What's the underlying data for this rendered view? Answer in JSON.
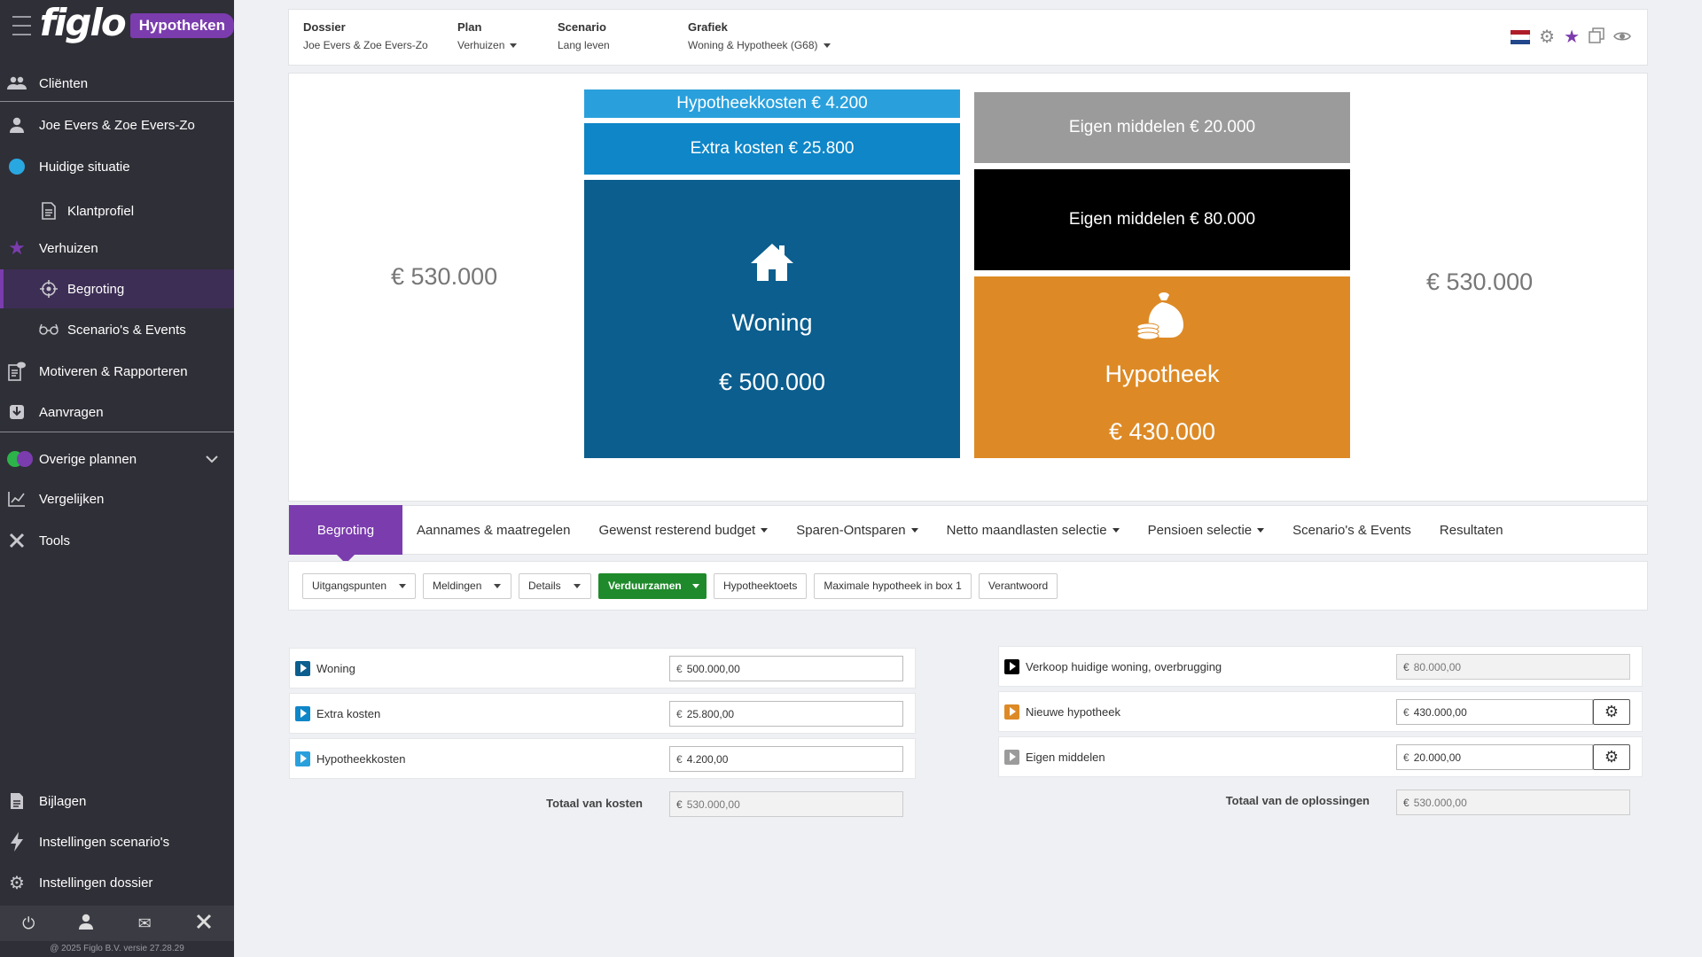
{
  "brand": {
    "logo": "figlo",
    "product": "Hypotheken"
  },
  "sidebar": {
    "items": [
      {
        "label": "Cliënten",
        "icon": "users-icon"
      },
      {
        "label": "Joe Evers & Zoe Evers-Zo",
        "icon": "user-icon"
      },
      {
        "label": "Huidige situatie",
        "icon": "blue-dot-icon"
      },
      {
        "label": "Klantprofiel",
        "icon": "document-icon"
      },
      {
        "label": "Verhuizen",
        "icon": "star-icon"
      },
      {
        "label": "Begroting",
        "icon": "crosshair-icon"
      },
      {
        "label": "Scenario's & Events",
        "icon": "glasses-icon"
      },
      {
        "label": "Motiveren & Rapporteren",
        "icon": "report-icon"
      },
      {
        "label": "Aanvragen",
        "icon": "inbox-icon"
      },
      {
        "label": "Overige plannen",
        "icon": "dots-icon"
      },
      {
        "label": "Vergelijken",
        "icon": "chart-line-icon"
      },
      {
        "label": "Tools",
        "icon": "tools-icon"
      },
      {
        "label": "Bijlagen",
        "icon": "file-icon"
      },
      {
        "label": "Instellingen scenario's",
        "icon": "bolt-icon"
      },
      {
        "label": "Instellingen dossier",
        "icon": "gear-icon"
      }
    ],
    "version": "@ 2025 Figlo B.V. versie 27.28.29"
  },
  "header": {
    "dossier_label": "Dossier",
    "dossier_value": "Joe Evers & Zoe Evers-Zo",
    "plan_label": "Plan",
    "plan_value": "Verhuizen",
    "scenario_label": "Scenario",
    "scenario_value": "Lang leven",
    "grafiek_label": "Grafiek",
    "grafiek_value": "Woning & Hypotheek (G68)"
  },
  "visual": {
    "total_left": "€ 530.000",
    "total_right": "€ 530.000",
    "hypotheekkosten": "Hypotheekkosten € 4.200",
    "extra_kosten": "Extra kosten € 25.800",
    "woning_label": "Woning",
    "woning_value": "€ 500.000",
    "eigen_middelen_1": "Eigen middelen € 20.000",
    "eigen_middelen_2": "Eigen middelen € 80.000",
    "hypotheek_label": "Hypotheek",
    "hypotheek_value": "€ 430.000",
    "colors": {
      "light_blue": "#29a0dc",
      "mid_blue": "#0e86c8",
      "dark_blue": "#0b5e8e",
      "grey": "#9b9b9b",
      "black": "#000000",
      "orange": "#dd8a26"
    }
  },
  "tabs": [
    {
      "label": "Begroting"
    },
    {
      "label": "Aannames & maatregelen"
    },
    {
      "label": "Gewenst resterend budget"
    },
    {
      "label": "Sparen-Ontsparen"
    },
    {
      "label": "Netto maandlasten selectie"
    },
    {
      "label": "Pensioen selectie"
    },
    {
      "label": "Scenario's & Events"
    },
    {
      "label": "Resultaten"
    }
  ],
  "toolbar": [
    {
      "label": "Uitgangspunten"
    },
    {
      "label": "Meldingen"
    },
    {
      "label": "Details"
    },
    {
      "label": "Verduurzamen"
    },
    {
      "label": "Hypotheektoets"
    },
    {
      "label": "Maximale hypotheek in box 1"
    },
    {
      "label": "Verantwoord"
    }
  ],
  "costs": {
    "rows": [
      {
        "label": "Woning",
        "value": "500.000,00"
      },
      {
        "label": "Extra kosten",
        "value": "25.800,00"
      },
      {
        "label": "Hypotheekkosten",
        "value": "4.200,00"
      }
    ],
    "total_label": "Totaal van kosten",
    "total_value": "530.000,00"
  },
  "solutions": {
    "rows": [
      {
        "label": "Verkoop huidige woning, overbrugging",
        "value": "80.000,00"
      },
      {
        "label": "Nieuwe hypotheek",
        "value": "430.000,00"
      },
      {
        "label": "Eigen middelen",
        "value": "20.000,00"
      }
    ],
    "total_label": "Totaal van de oplossingen",
    "total_value": "530.000,00"
  },
  "currency": "€"
}
